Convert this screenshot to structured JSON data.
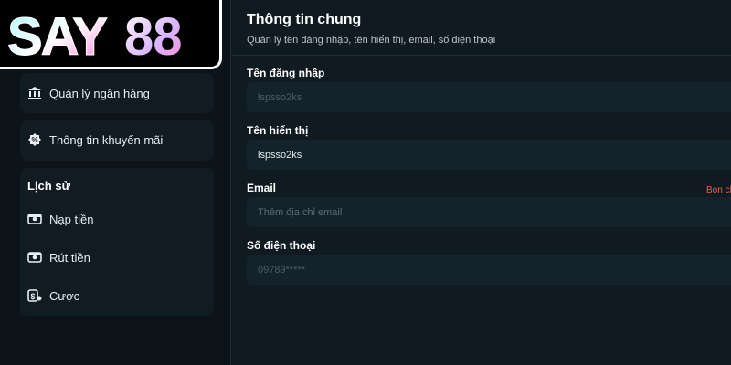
{
  "logo": {
    "text": "SAY88"
  },
  "sidebar": {
    "items_top": [
      {
        "label": "Quản lý ngân hàng",
        "icon": "bank-icon"
      },
      {
        "label": "Thông tin khuyến mãi",
        "icon": "promo-icon"
      }
    ],
    "history": {
      "title": "Lịch sử",
      "items": [
        {
          "label": "Nạp tiền",
          "icon": "deposit-icon"
        },
        {
          "label": "Rút tiền",
          "icon": "withdraw-icon"
        },
        {
          "label": "Cược",
          "icon": "bet-icon"
        }
      ]
    }
  },
  "main": {
    "title": "Thông tin chung",
    "subtitle": "Quản lý tên đăng nhập, tên hiển thị, email, số điện thoại",
    "fields": [
      {
        "label": "Tên đăng nhập",
        "value": "lspsso2ks",
        "placeholder": ""
      },
      {
        "label": "Tên hiển thị",
        "value": "lspsso2ks",
        "placeholder": ""
      },
      {
        "label": "Email",
        "value": "",
        "placeholder": "Thêm địa chỉ email",
        "link": "Bọn ch"
      },
      {
        "label": "Số điện thoại",
        "value": "09789*****",
        "placeholder": ""
      }
    ]
  },
  "colors": {
    "background": "#0b1319",
    "panel": "#0f1a21",
    "field": "#14222b",
    "link": "#e8624a"
  }
}
